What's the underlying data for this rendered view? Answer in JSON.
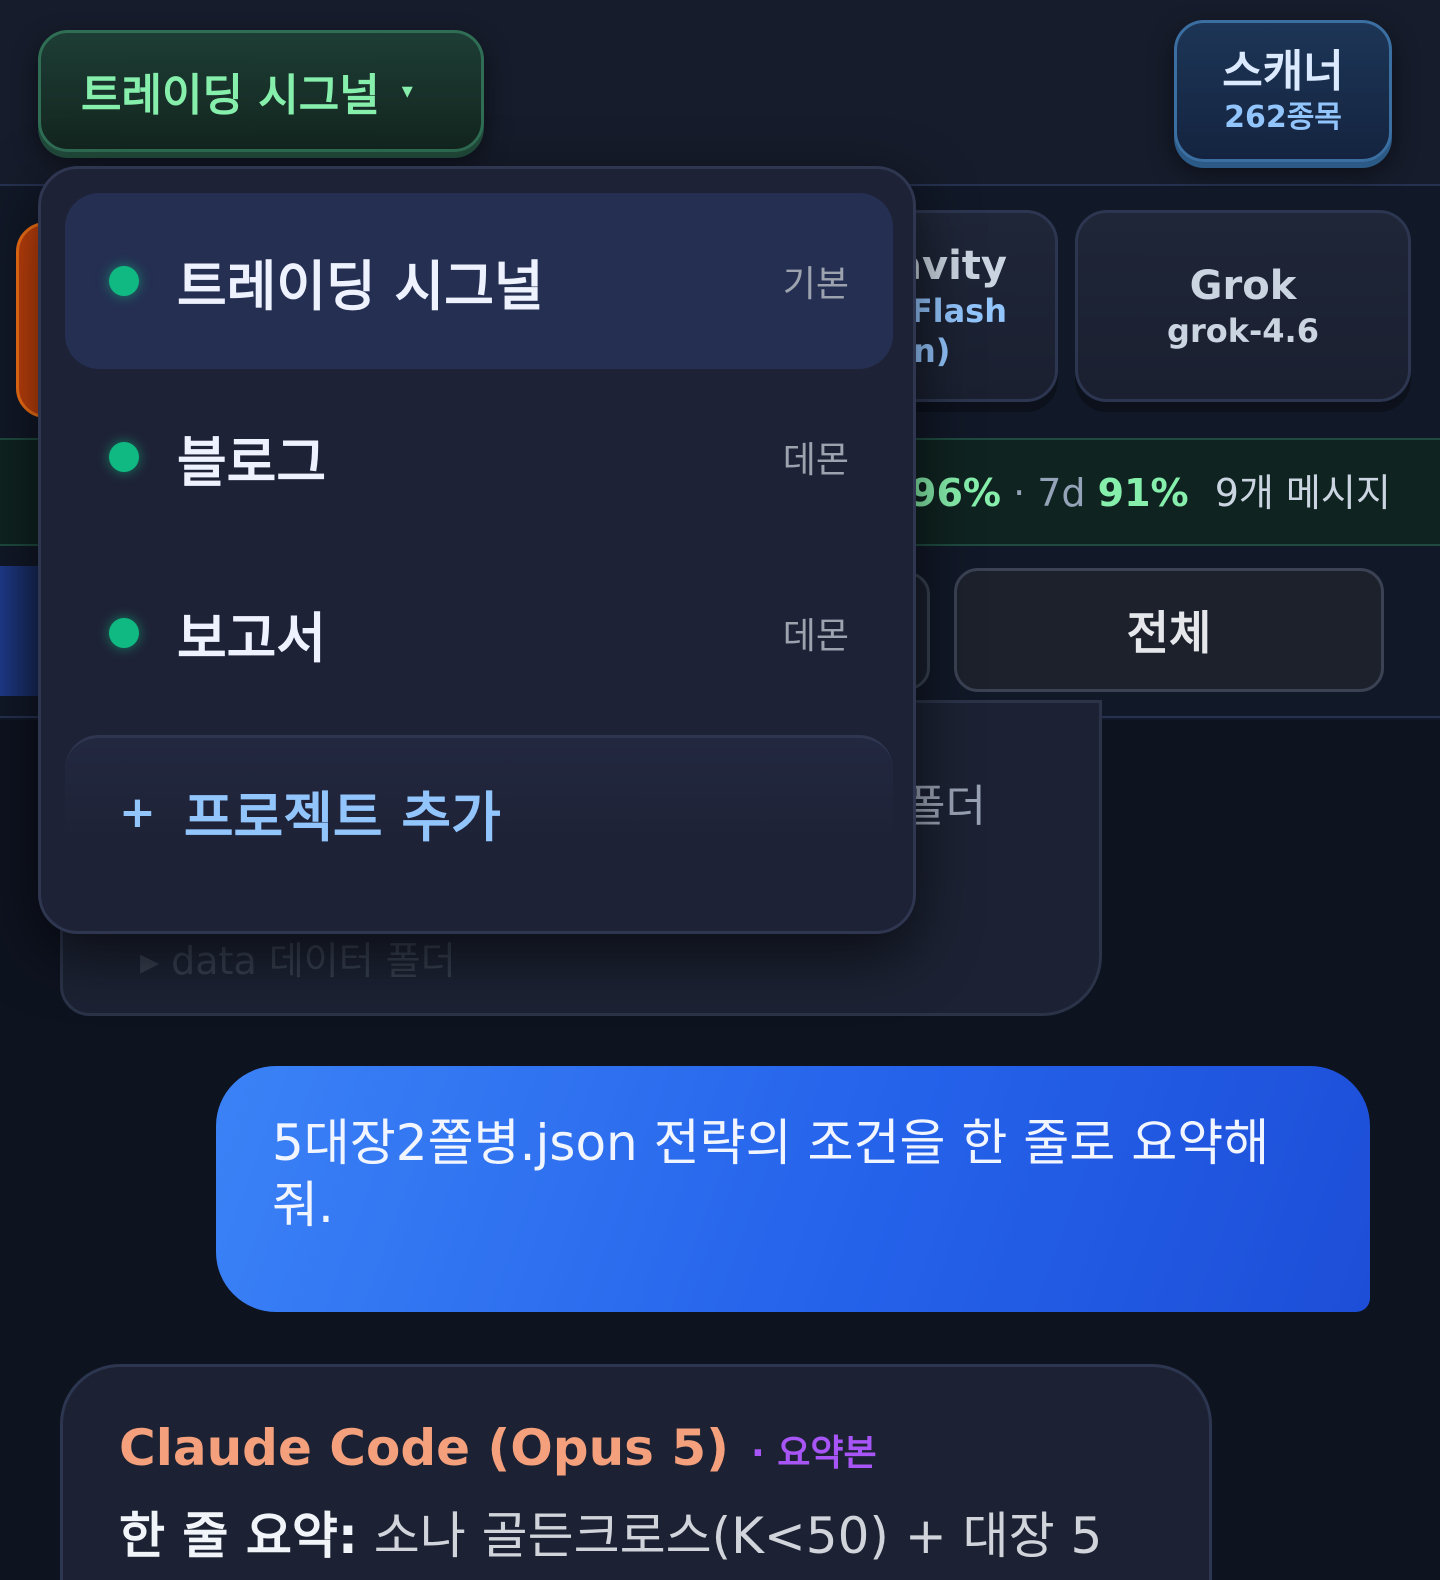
{
  "header": {
    "project_selector": {
      "label": "트레이딩 시그널",
      "caret": "▾"
    },
    "scanner": {
      "title": "스캐너",
      "count": "262종목"
    }
  },
  "models": {
    "antigravity": {
      "name_partial": "avity",
      "sub1_partial": "3 Flash",
      "sub2_partial": "n)"
    },
    "grok": {
      "name": "Grok",
      "version": "grok-4.6"
    }
  },
  "stats": {
    "pct1_partial": "96%",
    "sep": "·",
    "label_7d": "7d",
    "pct_7d": "91%",
    "messages": "9개 메시지"
  },
  "filters": {
    "all_label": "전체"
  },
  "background_card": {
    "text_partial": "폴더",
    "faded_line": "▸  data       데이터 폴더"
  },
  "dropdown": {
    "items": [
      {
        "label": "트레이딩 시그널",
        "badge": "기본",
        "active": true
      },
      {
        "label": "블로그",
        "badge": "데몬",
        "active": false
      },
      {
        "label": "보고서",
        "badge": "데몬",
        "active": false
      }
    ],
    "add_icon": "+",
    "add_label": "프로젝트 추가"
  },
  "chat": {
    "user_message": "5대장2쫄병.json 전략의 조건을 한 줄로 요약해줘.",
    "assistant": {
      "model": "Claude Code (Opus 5)",
      "tag": "· 요약본",
      "summary_label": "한 줄 요약:",
      "summary_text": "소나 골든크로스(K<50) + 대장 5"
    }
  },
  "colors": {
    "background": "#111827",
    "accent_green": "#86efac",
    "status_dot": "#10b981",
    "user_bubble": "#2563eb",
    "assistant_model": "#f4a07c",
    "tag_purple": "#a855f7"
  }
}
